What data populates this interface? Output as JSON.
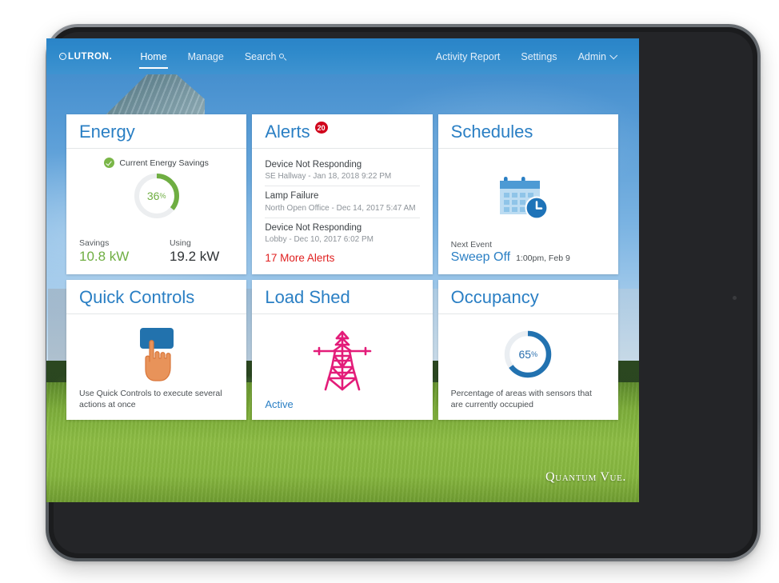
{
  "navbar": {
    "brand": "LUTRON",
    "brand_dot": ".",
    "left_items": [
      {
        "label": "Home",
        "active": true
      },
      {
        "label": "Manage",
        "active": false
      },
      {
        "label": "Search",
        "active": false,
        "icon": "search-icon"
      }
    ],
    "right_items": [
      {
        "label": "Activity Report"
      },
      {
        "label": "Settings"
      },
      {
        "label": "Admin",
        "icon": "chevron-down-icon"
      }
    ]
  },
  "cards": {
    "energy": {
      "title": "Energy",
      "savings_header": "Current Energy Savings",
      "savings_icon": "check-circle-icon",
      "gauge": {
        "value": 36,
        "suffix": "%",
        "color": "#6fae42",
        "track": "#eceef0"
      },
      "stats": [
        {
          "label": "Savings",
          "value": "10.8 kW",
          "color": "green"
        },
        {
          "label": "Using",
          "value": "19.2 kW",
          "color": "dark"
        }
      ]
    },
    "alerts": {
      "title": "Alerts",
      "badge": "20",
      "items": [
        {
          "title": "Device Not Responding",
          "meta": "SE Hallway - Jan 18, 2018 9:22 PM"
        },
        {
          "title": "Lamp Failure",
          "meta": "North Open Office - Dec 14, 2017 5:47 AM"
        },
        {
          "title": "Device Not Responding",
          "meta": "Lobby - Dec 10, 2017 6:02 PM"
        }
      ],
      "more_link": "17 More Alerts"
    },
    "schedules": {
      "title": "Schedules",
      "icon": "calendar-clock-icon",
      "next_event_label": "Next Event",
      "next_event_name": "Sweep Off",
      "next_event_time": "1:00pm, Feb 9"
    },
    "quick_controls": {
      "title": "Quick Controls",
      "icon": "hand-pressing-button-icon",
      "caption": "Use Quick Controls to execute several actions at once"
    },
    "load_shed": {
      "title": "Load Shed",
      "icon": "power-tower-icon",
      "status": "Active"
    },
    "occupancy": {
      "title": "Occupancy",
      "gauge": {
        "value": 65,
        "suffix": "%",
        "color": "#2272b0",
        "track": "#eaeef2"
      },
      "caption": "Percentage of areas with sensors that are currently occupied"
    }
  },
  "watermark": "Quantum Vue."
}
